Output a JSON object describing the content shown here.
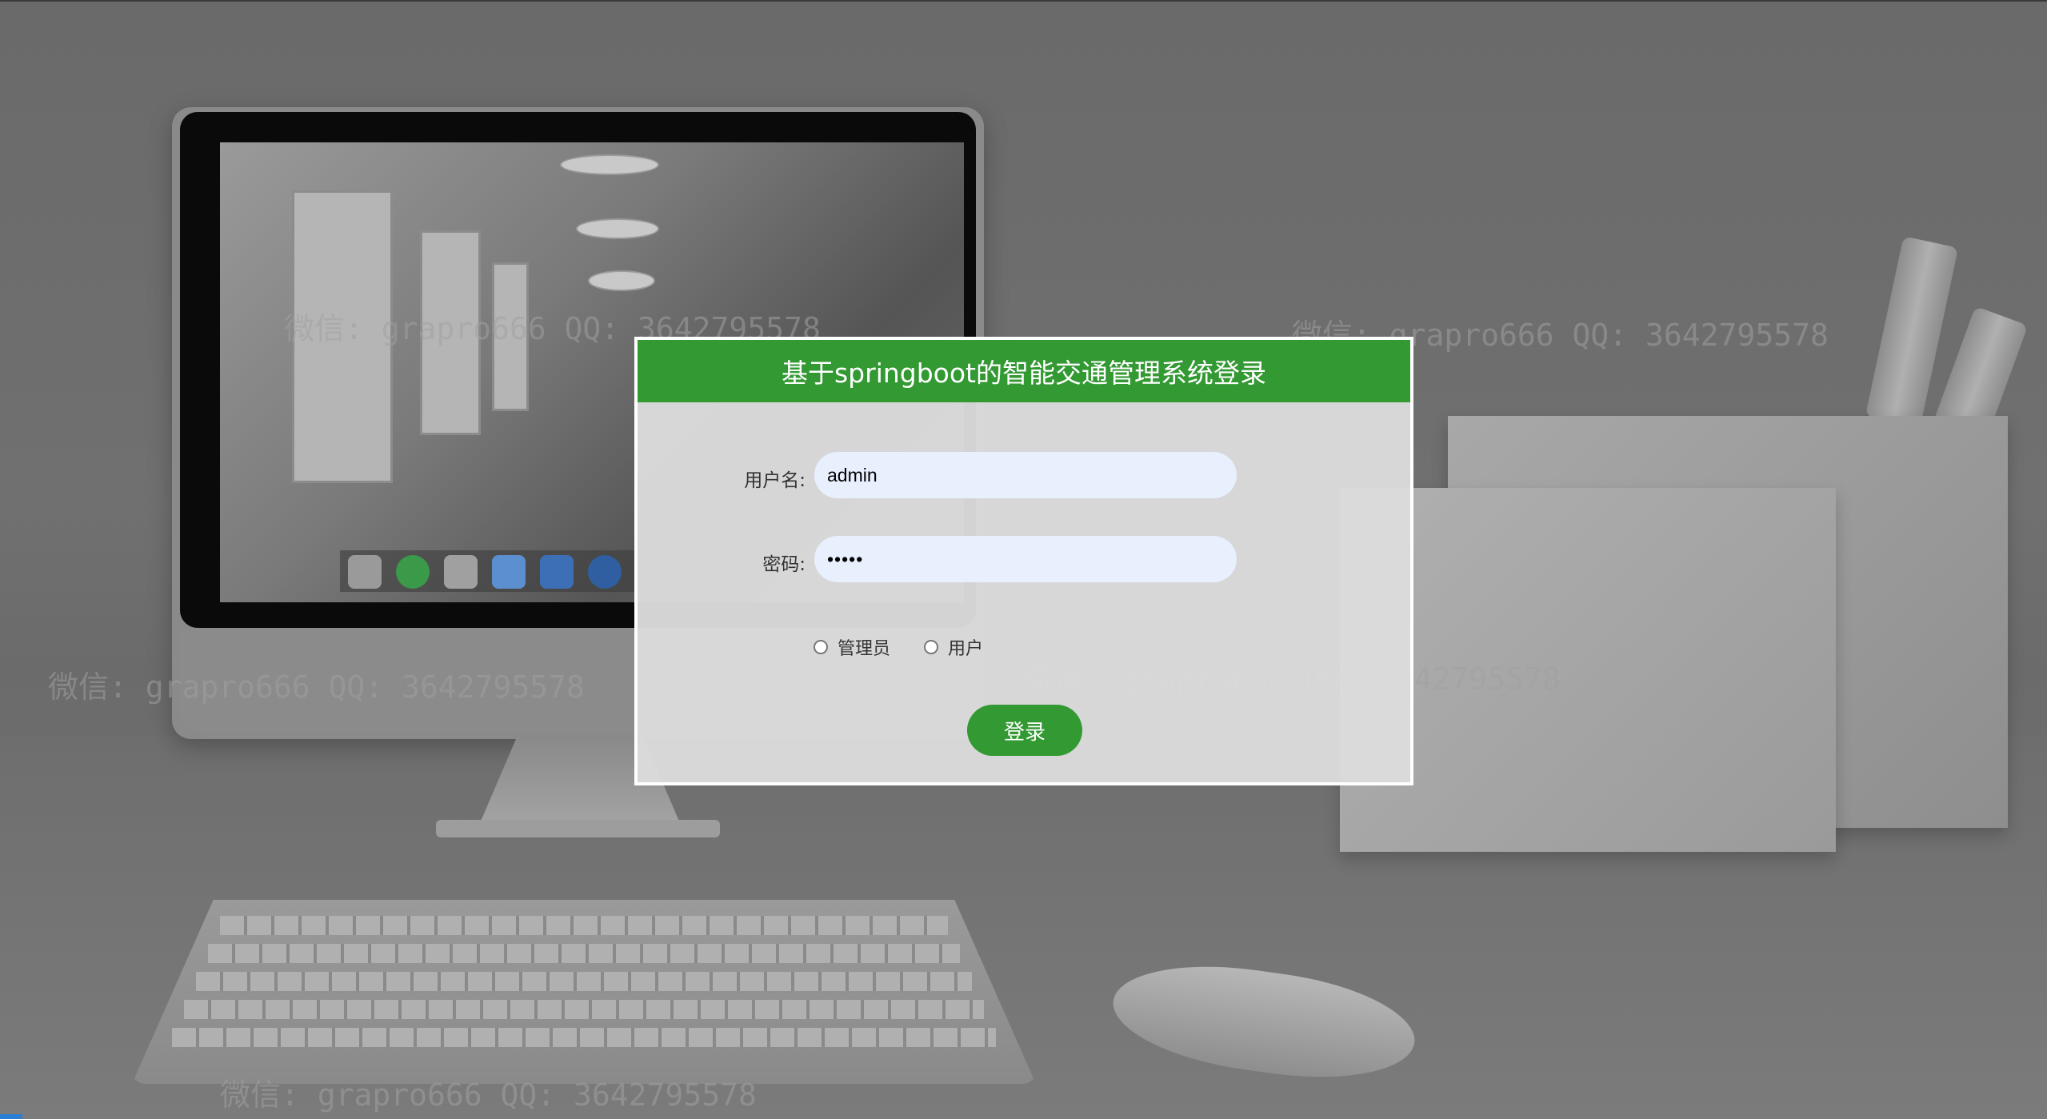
{
  "login": {
    "title": "基于springboot的智能交通管理系统登录",
    "username_label": "用户名:",
    "username_value": "admin",
    "password_label": "密码:",
    "password_value": "•••••",
    "roles": [
      {
        "label": "管理员",
        "selected": false
      },
      {
        "label": "用户",
        "selected": false
      }
    ],
    "submit_label": "登录"
  },
  "watermarks": [
    "微信: grapro666 QQ: 3642795578",
    "微信: grapro666 QQ: 3642795578",
    "微信: grapro666 QQ: 3642795578",
    "微信: grapro666 QQ: 3642795578",
    "微信: grapro666 QQ: 3642795578"
  ],
  "colors": {
    "header_bg": "#339933",
    "button_bg": "#339933",
    "input_bg": "#e8f0fe",
    "panel_border": "#ffffff"
  }
}
